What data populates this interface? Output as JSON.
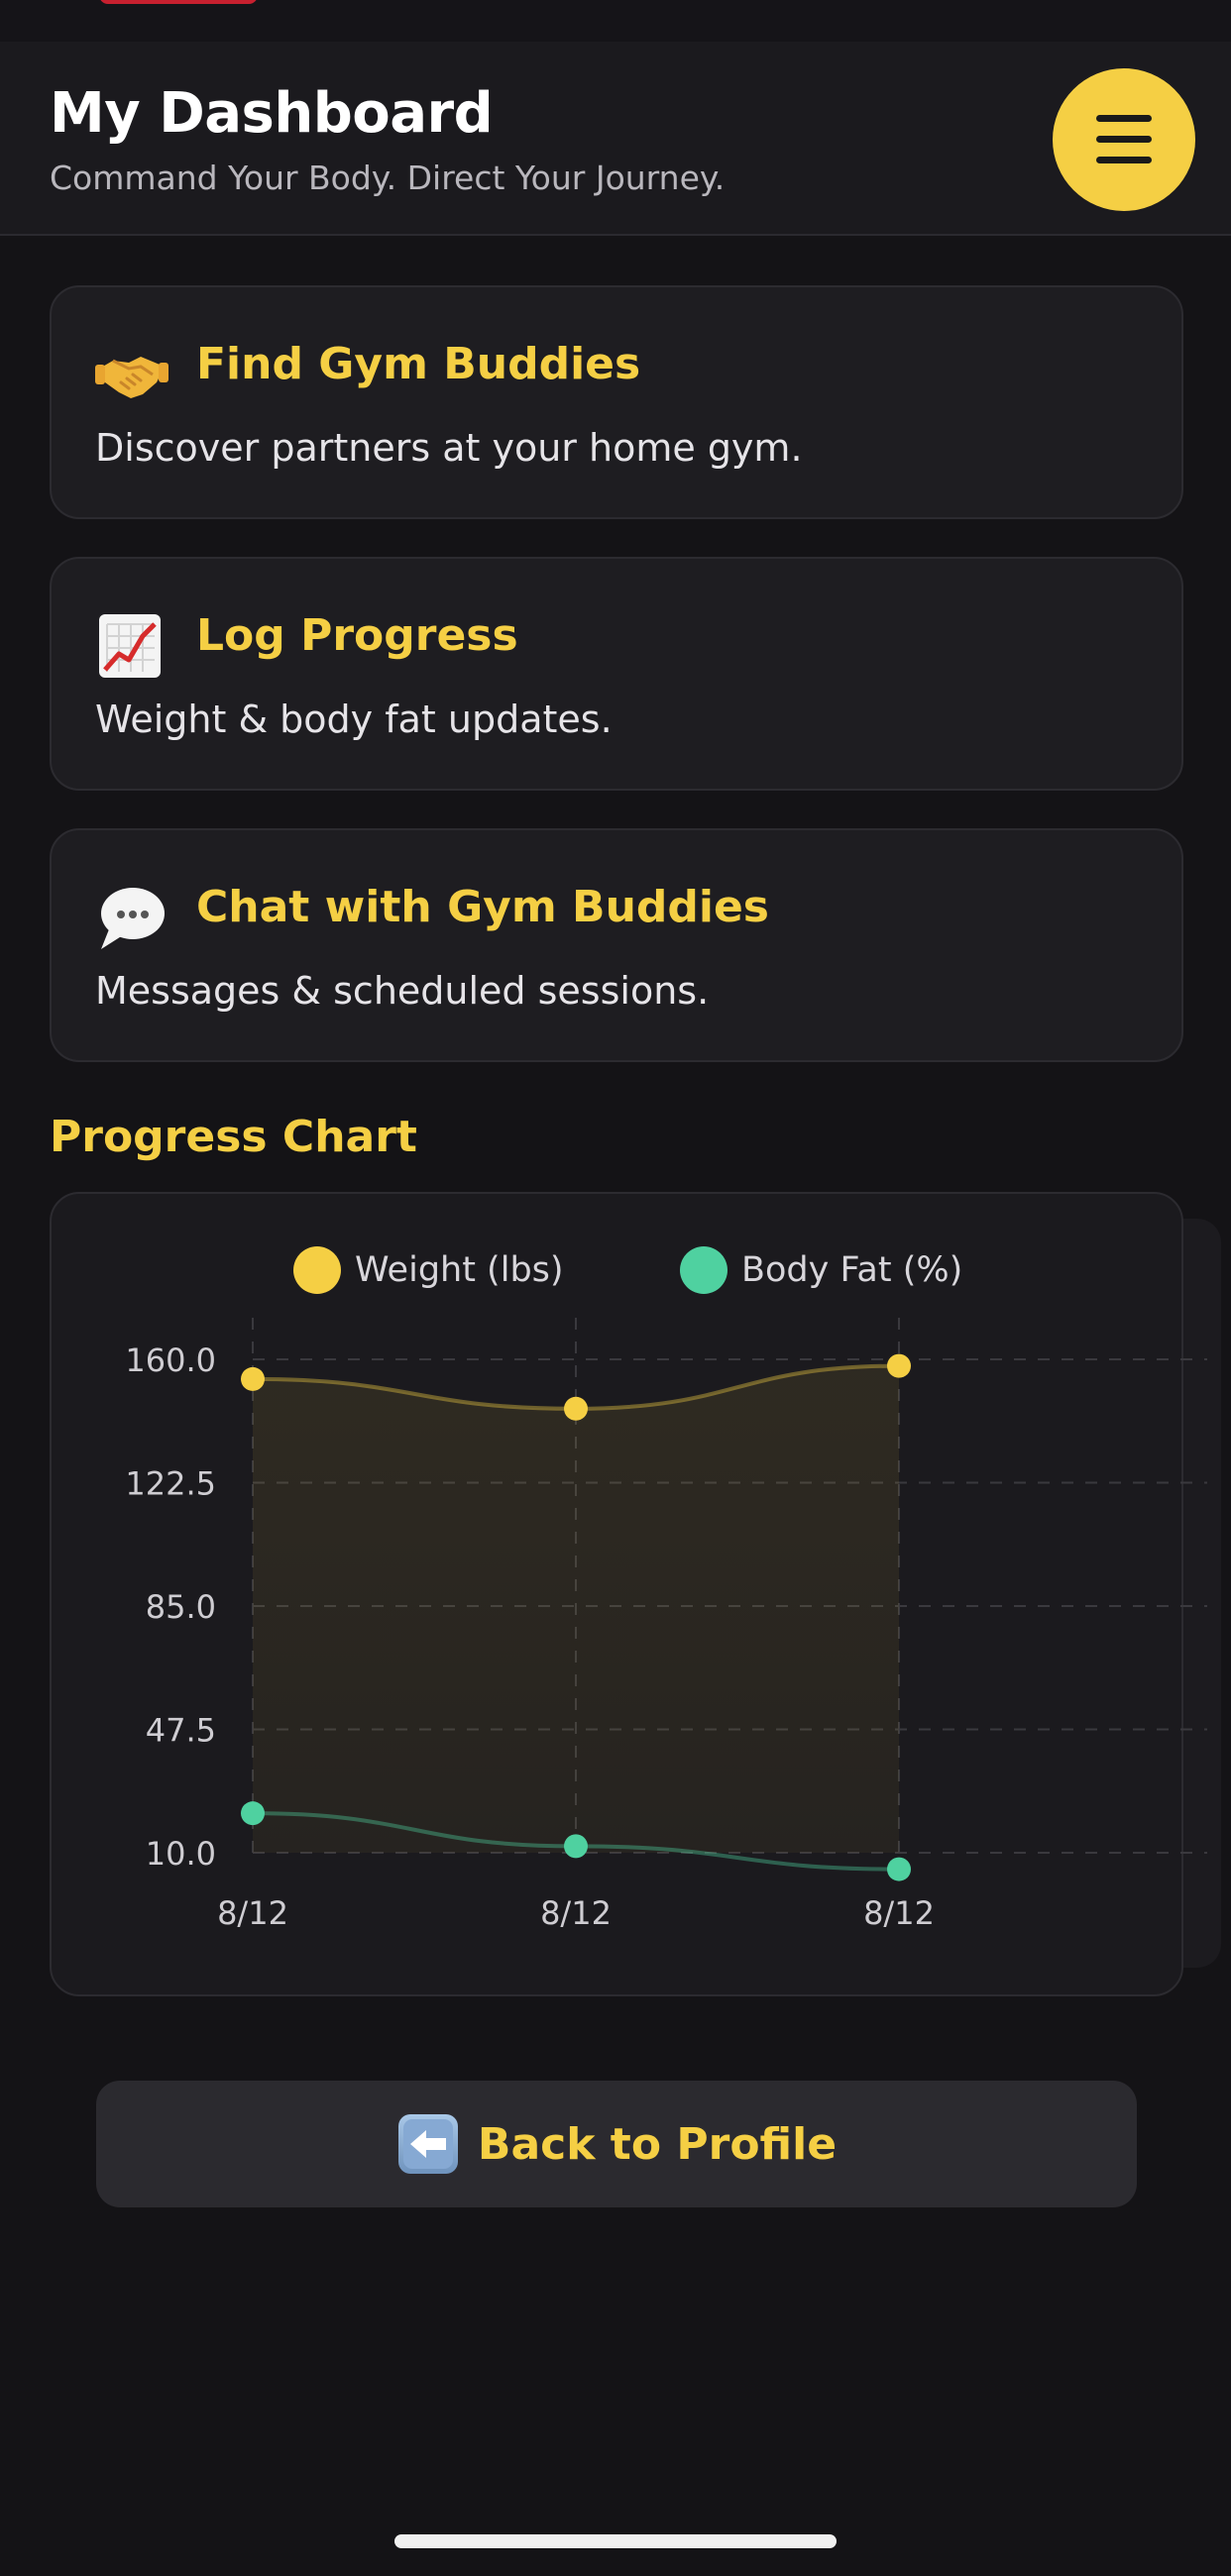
{
  "header": {
    "title": "My Dashboard",
    "subtitle": "Command Your Body. Direct Your Journey."
  },
  "cards": [
    {
      "icon": "handshake-icon",
      "title": "Find Gym Buddies",
      "description": "Discover partners at your home gym."
    },
    {
      "icon": "chart-increasing-icon",
      "title": "Log Progress",
      "description": "Weight & body fat updates."
    },
    {
      "icon": "speech-bubble-icon",
      "title": "Chat with Gym Buddies",
      "description": "Messages & scheduled sessions."
    }
  ],
  "progress_section": {
    "title": "Progress Chart"
  },
  "chart_data": {
    "type": "line",
    "categories": [
      "8/12",
      "8/12",
      "8/12"
    ],
    "series": [
      {
        "name": "Weight (lbs)",
        "values": [
          154,
          145,
          158
        ],
        "color": "#f5cf44",
        "fill": "area"
      },
      {
        "name": "Body Fat (%)",
        "values": [
          22,
          12,
          5
        ],
        "color": "#4fd1a0"
      }
    ],
    "y_ticks": [
      "160.0",
      "122.5",
      "85.0",
      "47.5",
      "10.0"
    ],
    "ylim": [
      10,
      160
    ],
    "grid": true,
    "legend": "top"
  },
  "back_button": {
    "icon": "left-arrow-icon",
    "label": "Back to Profile"
  },
  "colors": {
    "accent": "#f5cf44",
    "body_fat": "#4fd1a0",
    "background": "#141316",
    "card": "#1e1d21"
  }
}
